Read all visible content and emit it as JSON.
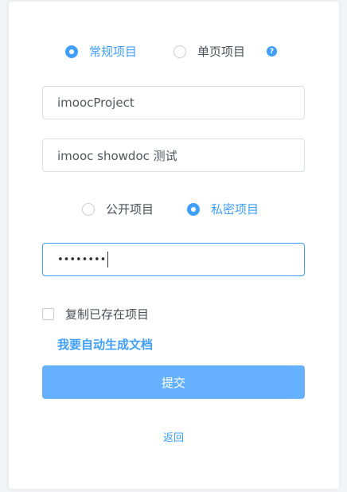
{
  "project_type": {
    "options": [
      "常规项目",
      "单页项目"
    ],
    "selected": "常规项目",
    "help_icon": "question-circle-icon",
    "help_glyph": "?"
  },
  "fields": {
    "project_name": "imoocProject",
    "project_description": "imooc showdoc 测试",
    "password_masked": "••••••••"
  },
  "visibility": {
    "options": [
      "公开项目",
      "私密项目"
    ],
    "selected": "私密项目"
  },
  "copy_existing": {
    "label": "复制已存在项目",
    "checked": false
  },
  "auto_doc_link": "我要自动生成文档",
  "submit_label": "提交",
  "back_label": "返回",
  "colors": {
    "accent": "#409eff",
    "submit_bg": "#66b1ff",
    "text": "#4a4f57",
    "border": "#dcdfe6"
  }
}
